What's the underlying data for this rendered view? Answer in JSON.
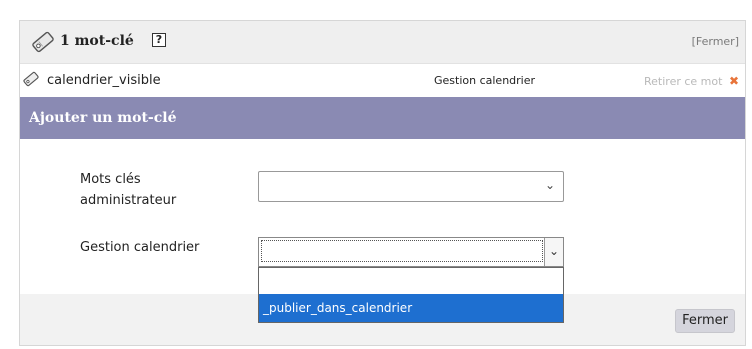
{
  "header": {
    "title": "1 mot-clé",
    "help_symbol": "?",
    "close_link": "[Fermer]"
  },
  "keyword_row": {
    "tag": "calendrier_visible",
    "group": "Gestion calendrier",
    "remove_label": "Retirer ce mot",
    "remove_symbol": "✖"
  },
  "add_section": {
    "title": "Ajouter un mot-clé"
  },
  "form": {
    "admin_label": "Mots clés administrateur",
    "admin_value": "",
    "calendar_label": "Gestion calendrier",
    "calendar_value": "",
    "calendar_options": [
      "",
      "_publier_dans_calendrier"
    ],
    "highlighted_option": "_publier_dans_calendrier"
  },
  "footer": {
    "close_button": "Fermer"
  },
  "colors": {
    "add_bar": "#8a8ab3",
    "dropdown_highlight": "#1e6fd0",
    "remove_icon": "#e8743a"
  },
  "icons": {
    "tag": "tag-icon",
    "help": "help-icon",
    "remove": "remove-x-icon",
    "chevron": "chevron-down-icon"
  }
}
